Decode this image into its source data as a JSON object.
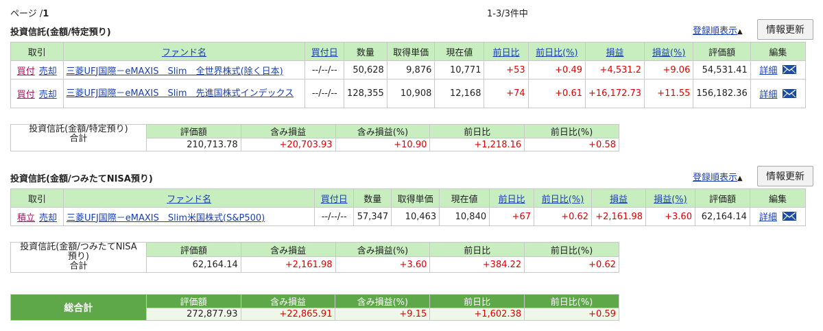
{
  "page_info": {
    "label": "ページ /",
    "page": "1"
  },
  "count_info": "1-3/3件中",
  "order_link": "登録順表示",
  "refresh_label": "情報更新",
  "columns": {
    "trade": "取引",
    "fund_name": "ファンド名",
    "buy_date": "買付日",
    "quantity": "数量",
    "acq_price": "取得単価",
    "current_price": "現在値",
    "day_change": "前日比",
    "day_change_pct": "前日比(%)",
    "pnl": "損益",
    "pnl_pct": "損益(%)",
    "valuation": "評価額",
    "edit": "編集"
  },
  "section1": {
    "title": "投資信託(金額/特定預り)",
    "rows": [
      {
        "action_buy": "買付",
        "action_sell": "売却",
        "name": "三菱UFJ国際－eMAXIS　Slim　全世界株式(除く日本)",
        "date": "--/--/--",
        "qty": "50,628",
        "acq": "9,876",
        "cur": "10,771",
        "chg": "+53",
        "chg_pct": "+0.49",
        "pnl": "+4,531.2",
        "pnl_pct": "+9.06",
        "val": "54,531.41",
        "detail": "詳細"
      },
      {
        "action_buy": "買付",
        "action_sell": "売却",
        "name": "三菱UFJ国際－eMAXIS　Slim　先進国株式インデックス",
        "date": "--/--/--",
        "qty": "128,355",
        "acq": "10,908",
        "cur": "12,168",
        "chg": "+74",
        "chg_pct": "+0.61",
        "pnl": "+16,172.73",
        "pnl_pct": "+11.55",
        "val": "156,182.36",
        "detail": "詳細"
      }
    ],
    "summary": {
      "label_line1": "投資信託(金額/特定預り)",
      "label_line2": "合計",
      "headers": [
        "評価額",
        "含み損益",
        "含み損益(%)",
        "前日比",
        "前日比(%)"
      ],
      "values": [
        "210,713.78",
        "+20,703.93",
        "+10.90",
        "+1,218.16",
        "+0.58"
      ]
    }
  },
  "section2": {
    "title": "投資信託(金額/つみたてNISA預り)",
    "rows": [
      {
        "action_buy": "積立",
        "action_sell": "売却",
        "name": "三菱UFJ国際－eMAXIS　Slim米国株式(S&P500)",
        "date": "--/--/--",
        "qty": "57,347",
        "acq": "10,463",
        "cur": "10,840",
        "chg": "+67",
        "chg_pct": "+0.62",
        "pnl": "+2,161.98",
        "pnl_pct": "+3.60",
        "val": "62,164.14",
        "detail": "詳細"
      }
    ],
    "summary": {
      "label_line1": "投資信託(金額/つみたてNISA",
      "label_line2": "預り)",
      "label_line3": "合計",
      "headers": [
        "評価額",
        "含み損益",
        "含み損益(%)",
        "前日比",
        "前日比(%)"
      ],
      "values": [
        "62,164.14",
        "+2,161.98",
        "+3.60",
        "+384.22",
        "+0.62"
      ]
    }
  },
  "grand_total": {
    "label": "総合計",
    "headers": [
      "評価額",
      "含み損益",
      "含み損益(%)",
      "前日比",
      "前日比(%)"
    ],
    "values": [
      "272,877.93",
      "+22,865.91",
      "+9.15",
      "+1,602.38",
      "+0.59"
    ]
  },
  "colors": {
    "header_green": "#c8eec0",
    "total_green": "#5ea84a",
    "positive_red": "#e00000",
    "link_blue": "#1a3fb0"
  }
}
